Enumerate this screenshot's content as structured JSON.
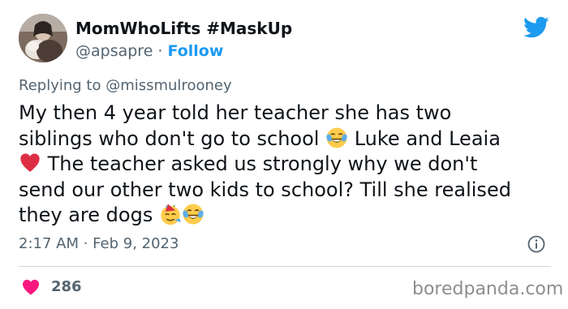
{
  "author": {
    "display_name": "MomWhoLifts #MaskUp",
    "handle": "@apsapre",
    "separator": " · ",
    "follow_label": "Follow"
  },
  "reply": {
    "prefix": "Replying to ",
    "handle": "@missmulrooney"
  },
  "tweet": {
    "line1": "My then 4 year told her teacher she has two",
    "line2_a": "siblings who don't go to school ",
    "line2_b": " Luke and Leaia",
    "line3": " The teacher asked us strongly why we don't",
    "line4": "send our other two kids to school? Till she realised",
    "line5": "they are dogs "
  },
  "meta": {
    "timestamp": "2:17 AM · Feb 9, 2023"
  },
  "engagement": {
    "likes": "286"
  },
  "watermark": "boredpanda.com",
  "icons": {
    "brand": "twitter-bird-icon",
    "info": "info-icon",
    "like": "heart-icon",
    "emojis": [
      "tears-of-joy-emoji",
      "red-heart-emoji",
      "party-face-emoji"
    ]
  },
  "colors": {
    "accent": "#1d9bf0",
    "like": "#f91880",
    "text": "#0f1419",
    "secondary": "#536471",
    "divider": "#cfd9de"
  }
}
